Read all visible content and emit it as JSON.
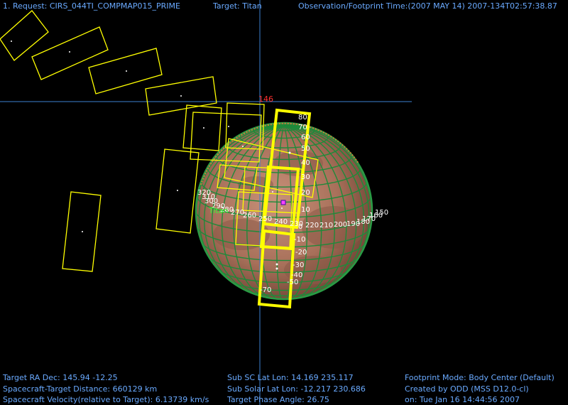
{
  "header": {
    "request": "1. Request: CIRS_044TI_COMPMAP015_PRIME",
    "target": "Target: Titan",
    "time": "Observation/Footprint Time:(2007 MAY 14) 2007-134T02:57:38.87"
  },
  "footer": {
    "ra_dec": "Target RA  Dec: 145.94   -12.25",
    "distance": "Spacecraft-Target Distance:  660129 km",
    "velocity": "Spacecraft Velocity(relative to Target): 6.13739 km/s",
    "sub_sc": "Sub SC Lat Lon: 14.169  235.117",
    "sub_solar": "Sub Solar Lat Lon: -12.217  230.686",
    "phase": "Target Phase Angle: 26.75",
    "footprint_mode": "Footprint Mode: Body Center (Default)",
    "created_by": "Created by ODD (MSS D12.0-cl)",
    "created_on": "on: Tue Jan 16 14:44:56 2007"
  },
  "view": {
    "crosshair_label": "146",
    "body_label": "Titan",
    "lat_labels": [
      "80",
      "70",
      "60",
      "50",
      "40",
      "30",
      "20",
      "10",
      "0",
      "-10",
      "-20",
      "-30",
      "-40",
      "-50",
      "-70"
    ],
    "lon_labels": [
      "150",
      "160",
      "170",
      "180",
      "190",
      "200",
      "210",
      "220",
      "230",
      "240",
      "250",
      "260",
      "270",
      "280",
      "290",
      "300",
      "310",
      "320"
    ],
    "colors": {
      "grid": "#1f8a3a",
      "planet": "#b07a5e",
      "footprint": "#ffff00",
      "crosshair": "#3c7fd0",
      "text": "#6aaaff",
      "label_red": "#ff3030",
      "label_green": "#33ff33"
    }
  }
}
